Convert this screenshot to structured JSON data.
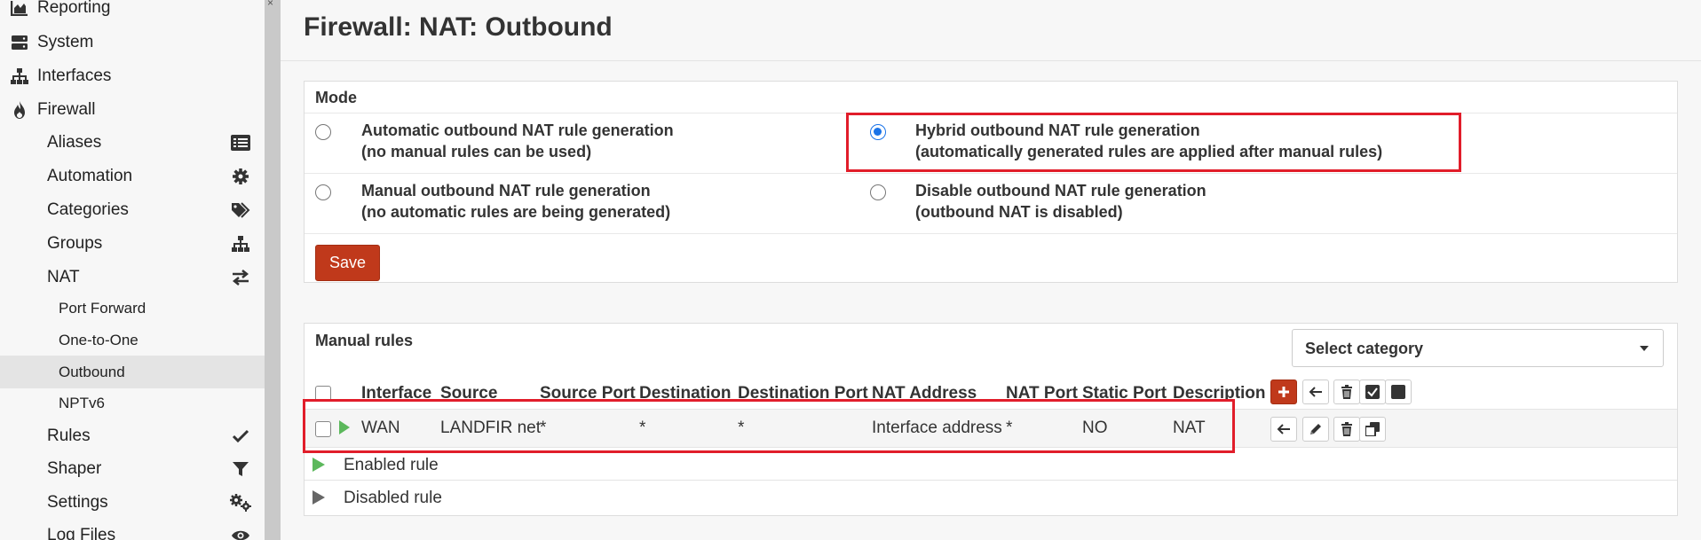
{
  "sidebar": {
    "items": [
      {
        "label": "Reporting",
        "icon": "chart-area-icon"
      },
      {
        "label": "System",
        "icon": "server-icon"
      },
      {
        "label": "Interfaces",
        "icon": "sitemap-icon"
      },
      {
        "label": "Firewall",
        "icon": "fire-icon"
      },
      {
        "label": "Aliases",
        "icon": "list-icon"
      },
      {
        "label": "Automation",
        "icon": "gear-icon"
      },
      {
        "label": "Categories",
        "icon": "tags-icon"
      },
      {
        "label": "Groups",
        "icon": "sitemap-icon"
      },
      {
        "label": "NAT",
        "icon": "exchange-icon"
      },
      {
        "label": "Port Forward"
      },
      {
        "label": "One-to-One"
      },
      {
        "label": "Outbound",
        "active": true
      },
      {
        "label": "NPTv6"
      },
      {
        "label": "Rules",
        "icon": "check-icon"
      },
      {
        "label": "Shaper",
        "icon": "filter-icon"
      },
      {
        "label": "Settings",
        "icon": "gears-icon"
      },
      {
        "label": "Log Files",
        "icon": "eye-icon"
      }
    ]
  },
  "page": {
    "title": "Firewall: NAT: Outbound"
  },
  "mode": {
    "header": "Mode",
    "options": {
      "automatic": {
        "line1": "Automatic outbound NAT rule generation",
        "line2": "(no manual rules can be used)",
        "checked": false
      },
      "hybrid": {
        "line1": "Hybrid outbound NAT rule generation",
        "line2": "(automatically generated rules are applied after manual rules)",
        "checked": true
      },
      "manual": {
        "line1": "Manual outbound NAT rule generation",
        "line2": "(no automatic rules are being generated)",
        "checked": false
      },
      "disable": {
        "line1": "Disable outbound NAT rule generation",
        "line2": "(outbound NAT is disabled)",
        "checked": false
      }
    },
    "save_label": "Save"
  },
  "rules": {
    "header": "Manual rules",
    "category_select": "Select category",
    "columns": [
      "Interface",
      "Source",
      "Source Port",
      "Destination",
      "Destination Port",
      "NAT Address",
      "NAT Port",
      "Static Port",
      "Description"
    ],
    "rows": [
      {
        "interface": "WAN",
        "source": "LANDFIR net",
        "source_port": "*",
        "destination": "*",
        "destination_port": "*",
        "nat_address": "Interface address",
        "nat_port": "*",
        "static_port": "NO",
        "description": "NAT"
      }
    ],
    "legend": {
      "enabled": "Enabled rule",
      "disabled": "Disabled rule"
    }
  },
  "colors": {
    "accent": "#c0391b",
    "highlight": "#e11d2a",
    "enabled_green": "#5cb85c",
    "disabled_gray": "#666666"
  }
}
